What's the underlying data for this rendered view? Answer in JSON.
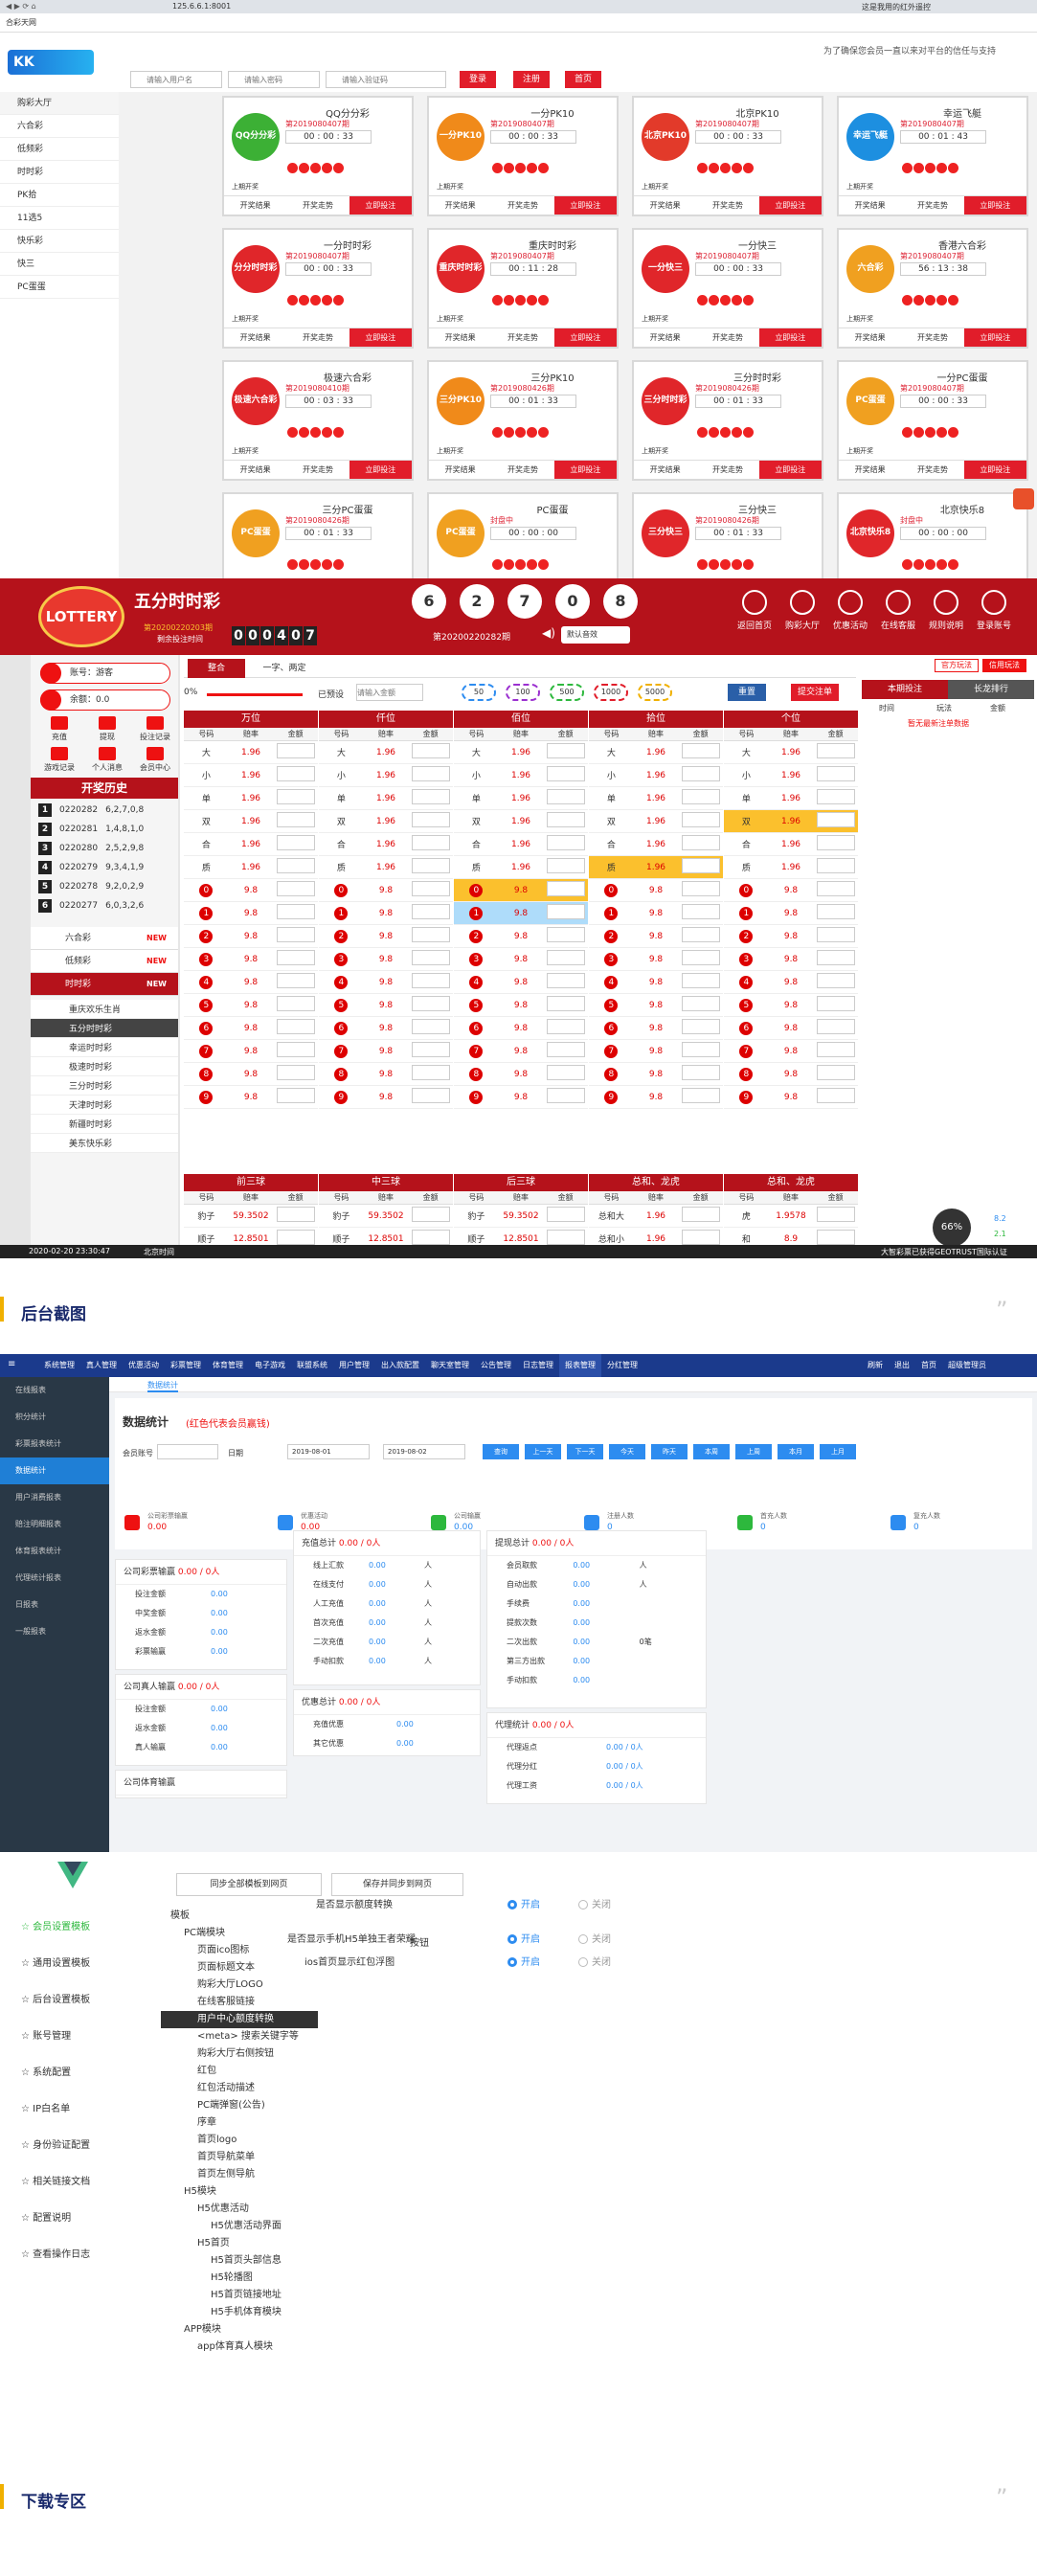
{
  "s1": {
    "browser_url": "125.6.6.1:8001",
    "browser_tab": "合彩天网",
    "slogan": "为了确保您会员一直以来对平台的信任与支持",
    "top_right": "这是我用的红外遥控",
    "placeholders": {
      "user": "请输入用户名",
      "pass": "请输入密码",
      "code": "请输入验证码"
    },
    "buttons": {
      "login": "登录",
      "register": "注册",
      "home": "首页"
    },
    "sidebar": [
      "购彩大厅",
      "六合彩",
      "低频彩",
      "时时彩",
      "PK拾",
      "11选5",
      "快乐彩",
      "快三",
      "PC蛋蛋"
    ],
    "games": [
      {
        "name": "QQ分分彩",
        "issue": "第2019080407期",
        "time": "00 : 00 : 33",
        "logo": "QQ分分彩",
        "color": "#3cb035"
      },
      {
        "name": "一分PK10",
        "issue": "第2019080407期",
        "time": "00 : 00 : 33",
        "logo": "一分PK10",
        "color": "#f08a1a"
      },
      {
        "name": "北京PK10",
        "issue": "第2019080407期",
        "time": "00 : 00 : 33",
        "logo": "北京PK10",
        "color": "#e23a2a"
      },
      {
        "name": "幸运飞艇",
        "issue": "第2019080407期",
        "time": "00 : 01 : 43",
        "logo": "幸运飞艇",
        "color": "#1d8fe0"
      },
      {
        "name": "一分时时彩",
        "issue": "第2019080407期",
        "time": "00 : 00 : 33",
        "logo": "分分时时彩",
        "color": "#e0262a"
      },
      {
        "name": "重庆时时彩",
        "issue": "第2019080407期",
        "time": "00 : 11 : 28",
        "logo": "重庆时时彩",
        "color": "#e0262a"
      },
      {
        "name": "一分快三",
        "issue": "第2019080407期",
        "time": "00 : 00 : 33",
        "logo": "一分快三",
        "color": "#e0262a"
      },
      {
        "name": "香港六合彩",
        "issue": "第2019080407期",
        "time": "56 : 13 : 38",
        "logo": "六合彩",
        "color": "#f0a020"
      },
      {
        "name": "极速六合彩",
        "issue": "第2019080410期",
        "time": "00 : 03 : 33",
        "logo": "极速六合彩",
        "color": "#e0262a"
      },
      {
        "name": "三分PK10",
        "issue": "第2019080426期",
        "time": "00 : 01 : 33",
        "logo": "三分PK10",
        "color": "#f08a1a"
      },
      {
        "name": "三分时时彩",
        "issue": "第2019080426期",
        "time": "00 : 01 : 33",
        "logo": "三分时时彩",
        "color": "#e0262a"
      },
      {
        "name": "一分PC蛋蛋",
        "issue": "第2019080407期",
        "time": "00 : 00 : 33",
        "logo": "PC蛋蛋",
        "color": "#f0a020"
      },
      {
        "name": "三分PC蛋蛋",
        "issue": "第2019080426期",
        "time": "00 : 01 : 33",
        "logo": "PC蛋蛋",
        "color": "#f0a020"
      },
      {
        "name": "PC蛋蛋",
        "issue": "封盘中",
        "time": "00 : 00 : 00",
        "logo": "PC蛋蛋",
        "color": "#f0a020"
      },
      {
        "name": "三分快三",
        "issue": "第2019080426期",
        "time": "00 : 01 : 33",
        "logo": "三分快三",
        "color": "#e0262a"
      },
      {
        "name": "北京快乐8",
        "issue": "封盘中",
        "time": "00 : 00 : 00",
        "logo": "北京快乐8",
        "color": "#e0262a"
      }
    ],
    "game_buttons": {
      "result": "开奖结果",
      "trend": "开奖走势",
      "bet": "立即投注"
    },
    "status_last": "上期开奖"
  },
  "s2": {
    "title": "五分时时彩",
    "issue_label": "第20200220203期",
    "issue_sub": "剩余投注时间",
    "countdown": [
      "0",
      "0",
      "0",
      "4",
      "0",
      "7"
    ],
    "balls": [
      "6",
      "2",
      "7",
      "0",
      "8"
    ],
    "draw_issue": "第20200220282期",
    "sound": "默认音效",
    "top_icons": [
      "返回首页",
      "购彩大厅",
      "优惠活动",
      "在线客服",
      "规则说明",
      "登录账号"
    ],
    "account": "账号：游客",
    "balance": "余额：0.0",
    "quick": [
      "充值",
      "提现",
      "投注记录",
      "游戏记录",
      "个人消息",
      "会员中心"
    ],
    "history_title": "开奖历史",
    "history": [
      {
        "n": "1",
        "issue": "0220282",
        "num": "6,2,7,0,8"
      },
      {
        "n": "2",
        "issue": "0220281",
        "num": "1,4,8,1,0"
      },
      {
        "n": "3",
        "issue": "0220280",
        "num": "2,5,2,9,8"
      },
      {
        "n": "4",
        "issue": "0220279",
        "num": "9,3,4,1,9"
      },
      {
        "n": "5",
        "issue": "0220278",
        "num": "9,2,0,2,9"
      },
      {
        "n": "6",
        "issue": "0220277",
        "num": "6,0,3,2,6"
      }
    ],
    "cat_menu": [
      {
        "label": "六合彩",
        "tag": "NEW"
      },
      {
        "label": "低频彩",
        "tag": "NEW"
      },
      {
        "label": "时时彩",
        "tag": "NEW"
      }
    ],
    "sub_menu": [
      "重庆欢乐生肖",
      "五分时时彩",
      "幸运时时彩",
      "极速时时彩",
      "三分时时彩",
      "天津时时彩",
      "新疆时时彩",
      "美东快乐彩"
    ],
    "tabs": [
      "整合",
      "一字、两定"
    ],
    "tab_right": [
      "官方玩法",
      "信用玩法"
    ],
    "quick_bet": {
      "pct": "0%",
      "preset": "已预设",
      "amount_ph": "请输入金额",
      "reset": "重置",
      "submit": "提交注单"
    },
    "chips": [
      "50",
      "100",
      "500",
      "1000",
      "5000"
    ],
    "positions": [
      "万位",
      "仟位",
      "佰位",
      "拾位",
      "个位"
    ],
    "col_heads": [
      "号码",
      "赔率",
      "金额"
    ],
    "big_rows": [
      {
        "k": "大",
        "o": "1.96"
      },
      {
        "k": "小",
        "o": "1.96"
      },
      {
        "k": "单",
        "o": "1.96"
      },
      {
        "k": "双",
        "o": "1.96"
      },
      {
        "k": "合",
        "o": "1.96"
      },
      {
        "k": "质",
        "o": "1.96"
      }
    ],
    "num_odds": "9.8",
    "lower_heads": [
      "前三球",
      "中三球",
      "后三球",
      "总和、龙虎",
      "总和、龙虎"
    ],
    "lower_rows": [
      {
        "k": "豹子",
        "o": "59.3502"
      },
      {
        "k": "顺子",
        "o": "12.8501"
      }
    ],
    "lower_extra": [
      {
        "k": "总和大",
        "o": "1.96"
      },
      {
        "k": "总和小",
        "o": "1.96"
      },
      {
        "k": "虎",
        "o": "1.9578"
      },
      {
        "k": "和",
        "o": "8.9"
      }
    ],
    "right_tabs": [
      "本期投注",
      "长龙排行"
    ],
    "right_cols": [
      "时间",
      "玩法",
      "金额"
    ],
    "right_empty": "暂无最新注单数据",
    "footer_time": "2020-02-20 23:30:47",
    "footer_tz": "北京时间",
    "footer_right": "大智彩票已获得GEOTRUST国际认证",
    "speed": "66%",
    "net_up": "8.2",
    "net_down": "2.1"
  },
  "s3": {
    "title": "后台截图"
  },
  "s4": {
    "nav": [
      "系统管理",
      "真人管理",
      "优惠活动",
      "彩票管理",
      "体育管理",
      "电子游戏",
      "联盟系统",
      "用户管理",
      "出入款配置",
      "聊天室管理",
      "公告管理",
      "日志管理",
      "报表管理",
      "分红管理"
    ],
    "nav_right": [
      "刷新",
      "退出",
      "首页",
      "超级管理员"
    ],
    "left": [
      "在线报表",
      "积分统计",
      "彩票报表统计",
      "数据统计",
      "用户消费报表",
      "赔注明细报表",
      "体育报表统计",
      "代理统计报表",
      "日报表",
      "一般报表"
    ],
    "tab": "数据统计",
    "title": "数据统计",
    "title_note": "(红色代表会员赢钱)",
    "filters": {
      "member": "会员账号",
      "date": "日期",
      "from": "2019-08-01",
      "to": "2019-08-02"
    },
    "filter_btns": [
      "查询",
      "上一天",
      "下一天",
      "今天",
      "昨天",
      "本周",
      "上周",
      "本月",
      "上月"
    ],
    "stats": [
      {
        "label": "公司彩票输赢",
        "val": "0.00"
      },
      {
        "label": "优惠活动",
        "val": "0.00"
      },
      {
        "label": "公司输赢",
        "val": "0.00"
      },
      {
        "label": "注册人数",
        "val": "0"
      },
      {
        "label": "首充人数",
        "val": "0"
      },
      {
        "label": "复充人数",
        "val": "0"
      }
    ],
    "panels": {
      "lottery": {
        "head": "公司彩票输赢",
        "val": "0.00 / 0人",
        "rows": [
          [
            "投注金额",
            "0.00"
          ],
          [
            "中奖金额",
            "0.00"
          ],
          [
            "返水金额",
            "0.00"
          ],
          [
            "彩票输赢",
            "0.00"
          ]
        ]
      },
      "live": {
        "head": "公司真人输赢",
        "val": "0.00 / 0人",
        "rows": [
          [
            "投注金额",
            "0.00"
          ],
          [
            "返水金额",
            "0.00"
          ],
          [
            "真人输赢",
            "0.00"
          ]
        ]
      },
      "sports": {
        "head": "公司体育输赢",
        "val": ""
      },
      "recharge": {
        "head": "充值总计",
        "val": "0.00 / 0人",
        "rows": [
          [
            "线上汇款",
            "0.00",
            "人"
          ],
          [
            "在线支付",
            "0.00",
            "人"
          ],
          [
            "人工充值",
            "0.00",
            "人"
          ],
          [
            "首次充值",
            "0.00",
            "人"
          ],
          [
            "二次充值",
            "0.00",
            "人"
          ],
          [
            "手动扣款",
            "0.00",
            "人"
          ]
        ]
      },
      "promo": {
        "head": "优惠总计",
        "val": "0.00 / 0人",
        "rows": [
          [
            "充值优惠",
            "0.00"
          ],
          [
            "其它优惠",
            "0.00"
          ]
        ]
      },
      "withdraw": {
        "head": "提现总计",
        "val": "0.00 / 0人",
        "rows": [
          [
            "会员取款",
            "0.00",
            "人"
          ],
          [
            "自动出款",
            "0.00",
            "人"
          ],
          [
            "手续费",
            "0.00",
            ""
          ],
          [
            "提款次数",
            "0.00",
            ""
          ],
          [
            "二次出款",
            "0.00",
            "0笔"
          ],
          [
            "第三方出款",
            "0.00",
            ""
          ],
          [
            "手动扣款",
            "0.00",
            ""
          ]
        ]
      },
      "agent": {
        "head": "代理统计",
        "val": "0.00 / 0人",
        "rows": [
          [
            "代理返点",
            "0.00 / 0人"
          ],
          [
            "代理分红",
            "0.00 / 0人"
          ],
          [
            "代理工资",
            "0.00 / 0人"
          ]
        ]
      }
    }
  },
  "s5": {
    "vmenu": [
      "会员设置模板",
      "通用设置模板",
      "后台设置模板",
      "账号管理",
      "系统配置",
      "IP白名单",
      "身份验证配置",
      "相关链接文档",
      "配置说明",
      "查看操作日志"
    ],
    "top_btns": [
      "同步全部模板到网页",
      "保存并同步到网页"
    ],
    "tree": [
      {
        "l": "模板",
        "d": 0
      },
      {
        "l": "PC端模块",
        "d": 1
      },
      {
        "l": "页面ico图标",
        "d": 2
      },
      {
        "l": "页面标题文本",
        "d": 2
      },
      {
        "l": "购彩大厅LOGO",
        "d": 2
      },
      {
        "l": "在线客服链接",
        "d": 2
      },
      {
        "l": "用户中心额度转换",
        "d": 2,
        "on": true
      },
      {
        "l": "<meta> 搜索关键字等",
        "d": 2
      },
      {
        "l": "购彩大厅右侧按钮",
        "d": 2
      },
      {
        "l": "红包",
        "d": 2
      },
      {
        "l": "红包活动描述",
        "d": 2
      },
      {
        "l": "PC端弹窗(公告)",
        "d": 2
      },
      {
        "l": "序章",
        "d": 2
      },
      {
        "l": "首页logo",
        "d": 2
      },
      {
        "l": "首页导航菜单",
        "d": 2
      },
      {
        "l": "首页左侧导航",
        "d": 2
      },
      {
        "l": "H5模块",
        "d": 1
      },
      {
        "l": "H5优惠活动",
        "d": 2
      },
      {
        "l": "H5优惠活动界面",
        "d": 3
      },
      {
        "l": "H5首页",
        "d": 2
      },
      {
        "l": "H5首页头部信息",
        "d": 3
      },
      {
        "l": "H5轮播图",
        "d": 3
      },
      {
        "l": "H5首页链接地址",
        "d": 3
      },
      {
        "l": "H5手机体育模块",
        "d": 3
      },
      {
        "l": "APP模块",
        "d": 1
      },
      {
        "l": "app体育真人模块",
        "d": 2
      }
    ],
    "opts": [
      {
        "label": "是否显示额度转换",
        "on": "开启",
        "off": "关闭"
      },
      {
        "label": "是否显示手机H5单独王者荣耀",
        "on": "开启",
        "off": "关闭"
      },
      {
        "label": "按钮",
        "on": "",
        "off": ""
      },
      {
        "label": "ios首页显示红包浮图",
        "on": "开启",
        "off": "关闭"
      }
    ]
  },
  "s6": {
    "title": "下载专区"
  }
}
